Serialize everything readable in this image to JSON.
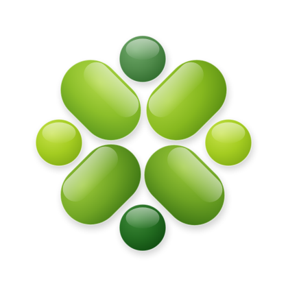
{
  "logo": {
    "icon": "green-glossy-blob-cluster-logo",
    "background_color": "#ffffff",
    "shape_count": 8,
    "shapes": [
      {
        "name": "top-circle-icon",
        "kind": "circle",
        "colors": {
          "light": "#6fa96a",
          "mid": "#4f8a4a",
          "dark": "#2e6a2b"
        }
      },
      {
        "name": "left-circle-icon",
        "kind": "circle",
        "colors": {
          "light": "#c7e24a",
          "mid": "#a4cc21",
          "dark": "#7faa15"
        }
      },
      {
        "name": "right-circle-icon",
        "kind": "circle",
        "colors": {
          "light": "#c7e24a",
          "mid": "#a4cc21",
          "dark": "#7faa15"
        }
      },
      {
        "name": "bottom-circle-icon",
        "kind": "circle",
        "colors": {
          "light": "#3f8a3a",
          "mid": "#226b20",
          "dark": "#0f4a10"
        }
      },
      {
        "name": "upper-left-petal-icon",
        "kind": "capsule",
        "colors": {
          "light": "#b4d94b",
          "mid": "#8cbf2a",
          "dark": "#5e9a1e"
        }
      },
      {
        "name": "upper-right-petal-icon",
        "kind": "capsule",
        "colors": {
          "light": "#a9d23a",
          "mid": "#86b81f",
          "dark": "#5b9014"
        }
      },
      {
        "name": "lower-left-petal-icon",
        "kind": "capsule",
        "colors": {
          "light": "#9cc93a",
          "mid": "#6fa424",
          "dark": "#3f7815"
        }
      },
      {
        "name": "lower-right-petal-icon",
        "kind": "capsule",
        "colors": {
          "light": "#9cc93a",
          "mid": "#6fa424",
          "dark": "#3f7815"
        }
      }
    ]
  }
}
